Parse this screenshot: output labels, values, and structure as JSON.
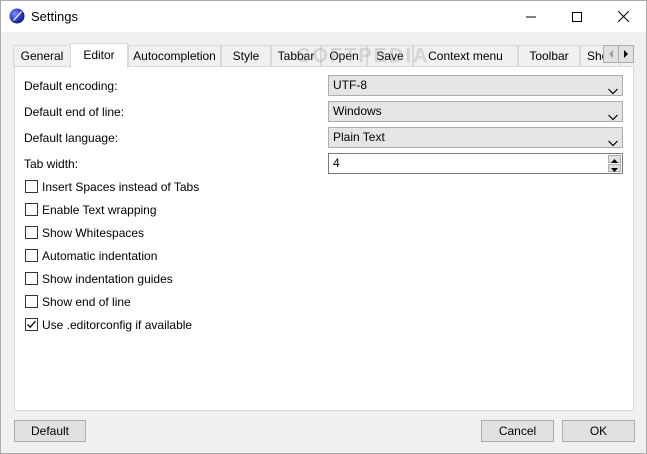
{
  "window": {
    "title": "Settings"
  },
  "watermark": "SOFTPEDIA",
  "tabs": [
    {
      "label": "General",
      "active": false
    },
    {
      "label": "Editor",
      "active": true
    },
    {
      "label": "Autocompletion",
      "active": false
    },
    {
      "label": "Style",
      "active": false
    },
    {
      "label": "Tabbar",
      "active": false
    },
    {
      "label": "Open",
      "active": false
    },
    {
      "label": "Save",
      "active": false
    },
    {
      "label": "Context menu",
      "active": false
    },
    {
      "label": "Toolbar",
      "active": false
    },
    {
      "label": "Sho",
      "active": false
    }
  ],
  "editor": {
    "encoding_label": "Default encoding:",
    "encoding_value": "UTF-8",
    "eol_label": "Default end of line:",
    "eol_value": "Windows",
    "language_label": "Default language:",
    "language_value": "Plain Text",
    "tab_width_label": "Tab width:",
    "tab_width_value": "4",
    "options": [
      {
        "label": "Insert Spaces instead of Tabs",
        "checked": false
      },
      {
        "label": "Enable Text wrapping",
        "checked": false
      },
      {
        "label": "Show Whitespaces",
        "checked": false
      },
      {
        "label": "Automatic indentation",
        "checked": false
      },
      {
        "label": "Show indentation guides",
        "checked": false
      },
      {
        "label": "Show end of line",
        "checked": false
      },
      {
        "label": "Use .editorconfig if available",
        "checked": true
      }
    ]
  },
  "footer": {
    "default_label": "Default",
    "cancel_label": "Cancel",
    "ok_label": "OK"
  },
  "colors": {
    "accent": "#2b3cc8",
    "panel": "#ffffff",
    "chrome": "#f0f0f0"
  }
}
